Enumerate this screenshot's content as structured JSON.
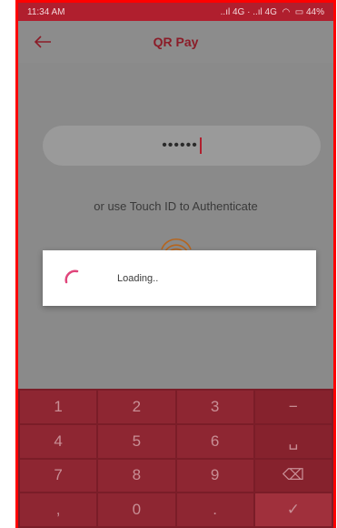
{
  "status_bar": {
    "time": "11:34 AM",
    "indicators": "..ıl 4G · ..ıl 4G",
    "battery": "44%"
  },
  "header": {
    "title": "QR Pay",
    "back_icon": "arrow-left-icon"
  },
  "pin": {
    "value": "••••••"
  },
  "touch_id": {
    "text": "or use Touch ID to Authenticate",
    "icon": "fingerprint-icon"
  },
  "dialog": {
    "message": "Loading.."
  },
  "keypad": {
    "keys": [
      {
        "label": "1",
        "name": "key-1"
      },
      {
        "label": "2",
        "name": "key-2"
      },
      {
        "label": "3",
        "name": "key-3"
      },
      {
        "label": "−",
        "name": "key-minus"
      },
      {
        "label": "4",
        "name": "key-4"
      },
      {
        "label": "5",
        "name": "key-5"
      },
      {
        "label": "6",
        "name": "key-6"
      },
      {
        "label": "␣",
        "name": "key-space"
      },
      {
        "label": "7",
        "name": "key-7"
      },
      {
        "label": "8",
        "name": "key-8"
      },
      {
        "label": "9",
        "name": "key-9"
      },
      {
        "label": "⌫",
        "name": "key-backspace"
      },
      {
        "label": ",",
        "name": "key-comma"
      },
      {
        "label": "0",
        "name": "key-0"
      },
      {
        "label": ".",
        "name": "key-period"
      },
      {
        "label": "✓",
        "name": "key-done"
      }
    ]
  },
  "colors": {
    "accent": "#b01f2e",
    "keypad": "#8e2632",
    "spinner": "#e0457b"
  }
}
